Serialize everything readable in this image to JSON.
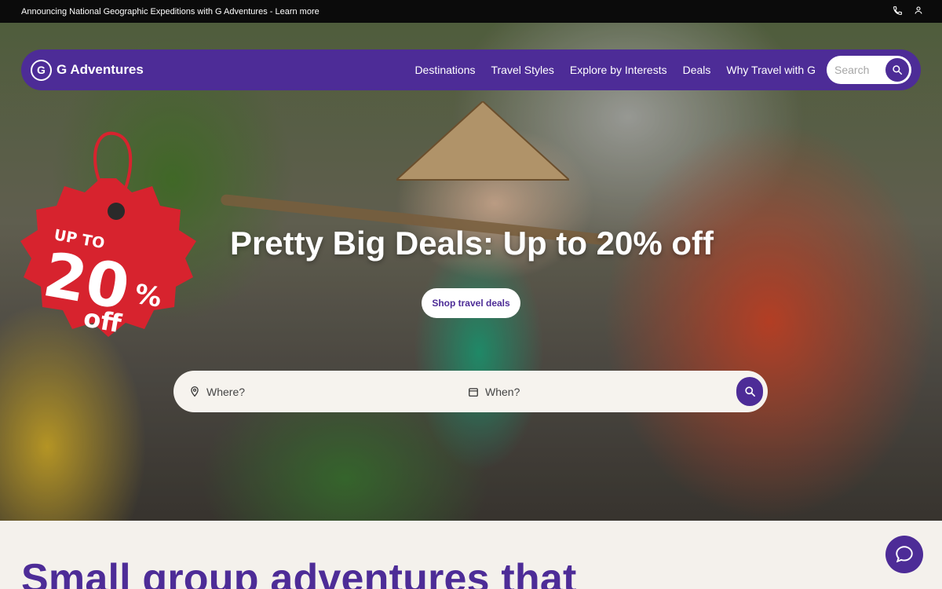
{
  "topbar": {
    "announcement": "Announcing National Geographic Expeditions with G Adventures - Learn more",
    "icons": [
      "phone-icon",
      "user-icon"
    ]
  },
  "nav": {
    "brand": "G Adventures",
    "links": [
      "Destinations",
      "Travel Styles",
      "Explore by Interests",
      "Deals",
      "Why Travel with G"
    ],
    "search_placeholder": "Search"
  },
  "hero": {
    "badge": {
      "line1": "UP TO",
      "line2": "20",
      "percent": "%",
      "line3": "off"
    },
    "headline": "Pretty Big Deals: Up to 20% off",
    "cta": "Shop travel deals"
  },
  "search": {
    "where_placeholder": "Where?",
    "when_placeholder": "When?"
  },
  "section": {
    "heading": "Small group adventures that"
  },
  "colors": {
    "brand_purple": "#4d2c97",
    "badge_red": "#d7232e",
    "topbar_black": "#0b0b0b",
    "cream": "#f4f1ec"
  }
}
